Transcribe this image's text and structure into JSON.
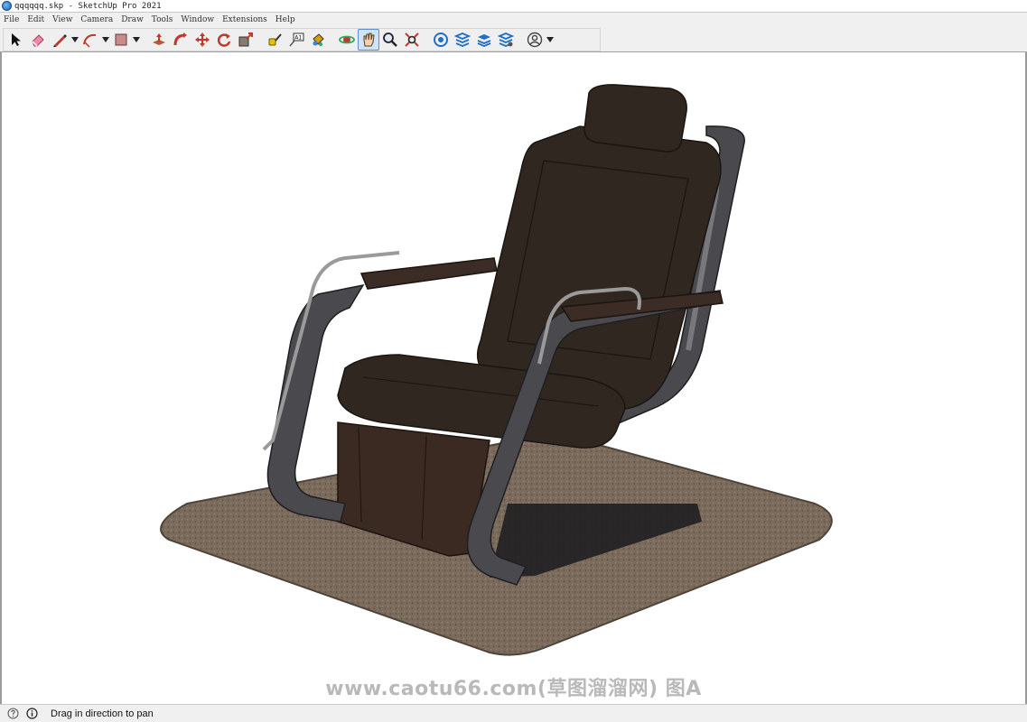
{
  "window": {
    "title": "qqqqqq.skp - SketchUp Pro 2021"
  },
  "menu": [
    "File",
    "Edit",
    "View",
    "Camera",
    "Draw",
    "Tools",
    "Window",
    "Extensions",
    "Help"
  ],
  "toolbar": {
    "tools": [
      {
        "icon": "select-arrow-icon"
      },
      {
        "icon": "eraser-icon"
      },
      {
        "icon": "pencil-line-icon"
      },
      {
        "icon": "arc-icon"
      },
      {
        "icon": "rectangle-shape-icon"
      },
      {
        "icon": "push-pull-icon"
      },
      {
        "icon": "follow-me-icon"
      },
      {
        "icon": "move-icon"
      },
      {
        "icon": "rotate-icon"
      },
      {
        "icon": "scale-icon"
      },
      {
        "icon": "tape-measure-icon"
      },
      {
        "icon": "text-icon"
      },
      {
        "icon": "paint-bucket-icon"
      },
      {
        "icon": "orbit-icon"
      },
      {
        "icon": "pan-hand-icon",
        "active": true
      },
      {
        "icon": "zoom-icon"
      },
      {
        "icon": "zoom-extents-icon"
      },
      {
        "icon": "3d-warehouse-icon"
      },
      {
        "icon": "extension-warehouse-icon"
      },
      {
        "icon": "layout-icon"
      },
      {
        "icon": "extension-manager-icon"
      },
      {
        "icon": "account-user-icon"
      }
    ],
    "text_tool_label": "A1"
  },
  "scene": {
    "description_note": "",
    "colors": {
      "rug": "#7b6b5c",
      "rug_edge": "#4f443a",
      "frame": "#4a4a4e",
      "frame_light": "#8a8a90",
      "cushion": "#2f2720",
      "cushion_edge": "#1a1510",
      "base_box": "#3a2a22",
      "armrest": "#3b2c25",
      "rail": "#9a9a9a"
    }
  },
  "watermark": {
    "text": "www.caotu66.com(草图溜溜网) 图A"
  },
  "status": {
    "hint": "Drag in direction to pan"
  }
}
